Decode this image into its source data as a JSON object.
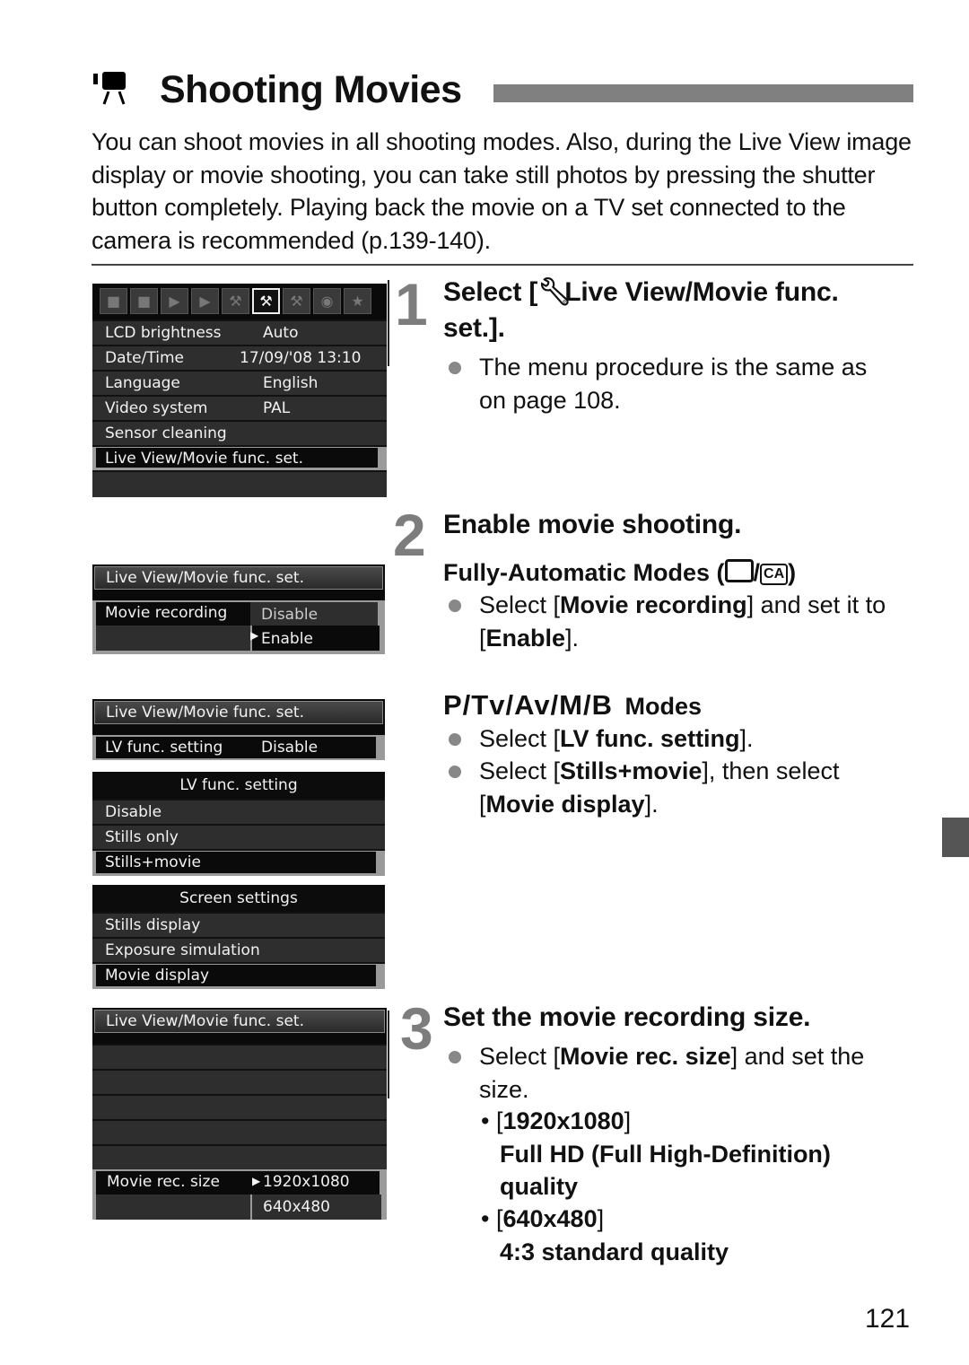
{
  "header": {
    "title": "Shooting Movies",
    "icon": "movie-camera-icon"
  },
  "intro": "You can shoot movies in all shooting modes. Also, during the Live View image display or movie shooting, you can take still photos by pressing the shutter button completely. Playing back the movie on a TV set connected to the camera is recommended (p.139-140).",
  "screens": {
    "setup_menu": {
      "tab_icons": [
        "shooting-1-icon",
        "shooting-2-icon",
        "playback-1-icon",
        "playback-2-icon",
        "setup-1-icon",
        "setup-2-icon",
        "setup-3-icon",
        "camera-icon",
        "my-menu-star-icon"
      ],
      "active_tab": 5,
      "items": [
        {
          "label": "LCD brightness",
          "value": "Auto"
        },
        {
          "label": "Date/Time",
          "value": "17/09/'08 13:10"
        },
        {
          "label": "Language",
          "value": "English"
        },
        {
          "label": "Video system",
          "value": "PAL"
        },
        {
          "label": "Sensor cleaning",
          "value": ""
        },
        {
          "label": "Live View/Movie func. set.",
          "value": ""
        }
      ],
      "selected_index": 5
    },
    "movie_recording": {
      "header": "Live View/Movie func. set.",
      "item": "Movie recording",
      "options": [
        "Disable",
        "Enable"
      ],
      "selected_option": "Enable"
    },
    "lv_func": {
      "header": "Live View/Movie func. set.",
      "item": "LV func. setting",
      "value": "Disable"
    },
    "lv_func_setting": {
      "header": "LV func. setting",
      "options": [
        "Disable",
        "Stills only",
        "Stills+movie"
      ],
      "selected_option": "Stills+movie"
    },
    "screen_settings": {
      "header": "Screen settings",
      "options": [
        "Stills display",
        "Exposure simulation",
        "Movie display"
      ],
      "selected_option": "Movie display"
    },
    "movie_rec_size": {
      "header": "Live View/Movie func. set.",
      "item": "Movie rec. size",
      "options": [
        "1920x1080",
        "640x480"
      ],
      "selected_option": "1920x1080"
    }
  },
  "steps": [
    {
      "number": "1",
      "title_prefix": "Select [",
      "title_icon": "setup-wrench-icon",
      "title_rest": " Live View/Movie func.",
      "title_line2": "set.].",
      "bullet_line1": "The menu procedure is the same as",
      "bullet_line2": "on page 108."
    },
    {
      "number": "2",
      "title": "Enable movie shooting.",
      "fully_auto_heading": "Fully-Automatic Modes (",
      "fully_auto_icons": [
        "full-auto-icon",
        "creative-auto-icon"
      ],
      "fully_auto_ca": "CA",
      "fully_auto_close": ")",
      "fa_bullet": {
        "pre": "Select [",
        "bold": "Movie recording",
        "post": "] and set it to",
        "line2_pre": "[",
        "line2_bold": "Enable",
        "line2_post": "]."
      },
      "creative_heading_modes": "P/Tv/Av/M/B",
      "creative_heading_suffix": "Modes",
      "cz_bullet1": {
        "pre": "Select [",
        "bold": "LV func. setting",
        "post": "]."
      },
      "cz_bullet2": {
        "pre": "Select [",
        "bold": "Stills+movie",
        "post": "], then select",
        "line2_pre": "[",
        "line2_bold": "Movie display",
        "line2_post": "]."
      }
    },
    {
      "number": "3",
      "title": "Set the movie recording size.",
      "bullet": {
        "pre": "Select [",
        "bold": "Movie rec. size",
        "post": "] and set the",
        "line2": "size."
      },
      "sizes": [
        {
          "label": "1920x1080",
          "desc_line1": "Full HD (Full High-Definition)",
          "desc_line2": "quality"
        },
        {
          "label": "640x480",
          "desc_line1": "4:3 standard quality"
        }
      ]
    }
  ],
  "page_number": "121"
}
